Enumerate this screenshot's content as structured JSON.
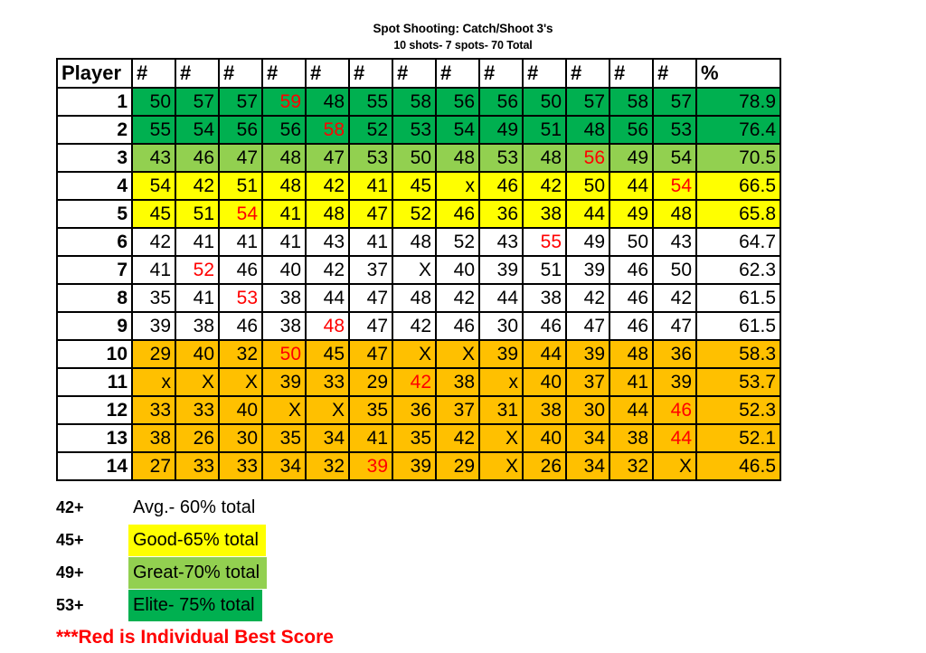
{
  "title": {
    "line1": "Spot Shooting: Catch/Shoot 3's",
    "line2": "10 shots- 7 spots- 70 Total"
  },
  "table": {
    "headers": [
      "Player",
      "#",
      "#",
      "#",
      "#",
      "#",
      "#",
      "#",
      "#",
      "#",
      "#",
      "#",
      "#",
      "#",
      "%"
    ],
    "rows": [
      {
        "player": "1",
        "band": "band-elite",
        "cells": [
          "50",
          "57",
          "57",
          "59",
          "48",
          "55",
          "58",
          "56",
          "56",
          "50",
          "57",
          "58",
          "57"
        ],
        "best_index": 3,
        "miss_indexes": [],
        "pct": "78.9"
      },
      {
        "player": "2",
        "band": "band-elite",
        "cells": [
          "55",
          "54",
          "56",
          "56",
          "58",
          "52",
          "53",
          "54",
          "49",
          "51",
          "48",
          "56",
          "53"
        ],
        "best_index": 4,
        "miss_indexes": [],
        "pct": "76.4"
      },
      {
        "player": "3",
        "band": "band-great",
        "cells": [
          "43",
          "46",
          "47",
          "48",
          "47",
          "53",
          "50",
          "48",
          "53",
          "48",
          "56",
          "49",
          "54"
        ],
        "best_index": 10,
        "miss_indexes": [],
        "pct": "70.5"
      },
      {
        "player": "4",
        "band": "band-good",
        "cells": [
          "54",
          "42",
          "51",
          "48",
          "42",
          "41",
          "45",
          "x",
          "46",
          "42",
          "50",
          "44",
          "54"
        ],
        "best_index": 12,
        "miss_indexes": [
          7
        ],
        "pct": "66.5"
      },
      {
        "player": "5",
        "band": "band-good",
        "cells": [
          "45",
          "51",
          "54",
          "41",
          "48",
          "47",
          "52",
          "46",
          "36",
          "38",
          "44",
          "49",
          "48"
        ],
        "best_index": 2,
        "miss_indexes": [],
        "pct": "65.8"
      },
      {
        "player": "6",
        "band": "band-avg",
        "cells": [
          "42",
          "41",
          "41",
          "41",
          "43",
          "41",
          "48",
          "52",
          "43",
          "55",
          "49",
          "50",
          "43"
        ],
        "best_index": 9,
        "miss_indexes": [],
        "pct": "64.7"
      },
      {
        "player": "7",
        "band": "band-avg",
        "cells": [
          "41",
          "52",
          "46",
          "40",
          "42",
          "37",
          "X",
          "40",
          "39",
          "51",
          "39",
          "46",
          "50"
        ],
        "best_index": 1,
        "miss_indexes": [
          6
        ],
        "pct": "62.3"
      },
      {
        "player": "8",
        "band": "band-avg",
        "cells": [
          "35",
          "41",
          "53",
          "38",
          "44",
          "47",
          "48",
          "42",
          "44",
          "38",
          "42",
          "46",
          "42"
        ],
        "best_index": 2,
        "miss_indexes": [],
        "pct": "61.5"
      },
      {
        "player": "9",
        "band": "band-avg",
        "cells": [
          "39",
          "38",
          "46",
          "38",
          "48",
          "47",
          "42",
          "46",
          "30",
          "46",
          "47",
          "46",
          "47"
        ],
        "best_index": 4,
        "miss_indexes": [],
        "pct": "61.5"
      },
      {
        "player": "10",
        "band": "band-low",
        "cells": [
          "29",
          "40",
          "32",
          "50",
          "45",
          "47",
          "X",
          "X",
          "39",
          "44",
          "39",
          "48",
          "36"
        ],
        "best_index": 3,
        "miss_indexes": [
          6,
          7
        ],
        "pct": "58.3"
      },
      {
        "player": "11",
        "band": "band-low",
        "cells": [
          "x",
          "X",
          "X",
          "39",
          "33",
          "29",
          "42",
          "38",
          "x",
          "40",
          "37",
          "41",
          "39"
        ],
        "best_index": 6,
        "miss_indexes": [
          8
        ],
        "pct": "53.7"
      },
      {
        "player": "12",
        "band": "band-low",
        "cells": [
          "33",
          "33",
          "40",
          "X",
          "X",
          "35",
          "36",
          "37",
          "31",
          "38",
          "30",
          "44",
          "46"
        ],
        "best_index": 12,
        "miss_indexes": [
          3,
          4
        ],
        "pct": "52.3"
      },
      {
        "player": "13",
        "band": "band-low",
        "cells": [
          "38",
          "26",
          "30",
          "35",
          "34",
          "41",
          "35",
          "42",
          "X",
          "40",
          "34",
          "38",
          "44"
        ],
        "best_index": 12,
        "miss_indexes": [
          8
        ],
        "pct": "52.1"
      },
      {
        "player": "14",
        "band": "band-low",
        "cells": [
          "27",
          "33",
          "33",
          "34",
          "32",
          "39",
          "39",
          "29",
          "X",
          "26",
          "34",
          "32",
          "X"
        ],
        "best_index": 5,
        "miss_indexes": [
          8,
          12
        ],
        "pct": "46.5"
      }
    ]
  },
  "legend": {
    "rows": [
      {
        "threshold": "42+",
        "label": "Avg.- 60% total",
        "band": "band-avg"
      },
      {
        "threshold": "45+",
        "label": "Good-65% total",
        "band": "band-good"
      },
      {
        "threshold": "49+",
        "label": "Great-70% total",
        "band": "band-great"
      },
      {
        "threshold": "53+",
        "label": "Elite- 75% total",
        "band": "band-elite"
      }
    ],
    "note": "***Red is Individual Best Score"
  },
  "colors": {
    "elite": "#00b050",
    "great": "#92d050",
    "good": "#ffff00",
    "avg": "#ffffff",
    "low": "#ffc000",
    "best_score": "#ff0000"
  }
}
